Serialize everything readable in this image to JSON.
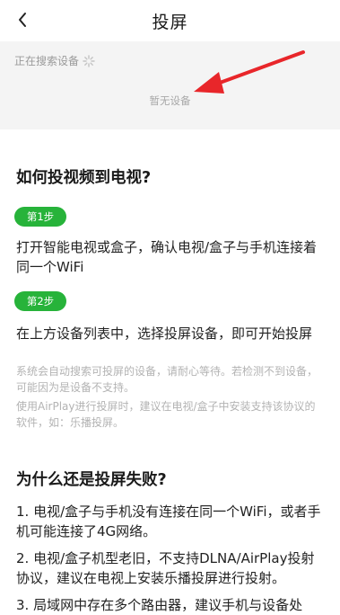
{
  "header": {
    "title": "投屏",
    "back_icon": "chevron-left-icon"
  },
  "device_panel": {
    "searching_text": "正在搜索设备",
    "spinner_icon": "loading-spinner-icon",
    "empty_text": "暂无设备"
  },
  "guide": {
    "heading": "如何投视频到电视?",
    "step1_label": "第1步",
    "step1_text": "打开智能电视或盒子，确认电视/盒子与手机连接着同一个WiFi",
    "step2_label": "第2步",
    "step2_text": "在上方设备列表中，选择投屏设备，即可开始投屏",
    "note1": "系统会自动搜索可投屏的设备，请耐心等待。若检测不到设备，可能因为是设备不支持。",
    "note2": "使用AirPlay进行投屏时，建议在电视/盒子中安装支持该协议的软件，如：乐播投屏。"
  },
  "failure": {
    "heading": "为什么还是投屏失败?",
    "item1": "1. 电视/盒子与手机没有连接在同一个WiFi，或者手机可能连接了4G网络。",
    "item2": "2. 电视/盒子机型老旧，不支持DLNA/AirPlay投射协议，建议在电视上安装乐播投屏进行投射。",
    "item3": "3. 局域网中存在多个路由器，建议手机与设备处"
  },
  "colors": {
    "accent_green": "#27b33a",
    "arrow_red": "#e8262a",
    "panel_bg": "#f4f4f4"
  }
}
